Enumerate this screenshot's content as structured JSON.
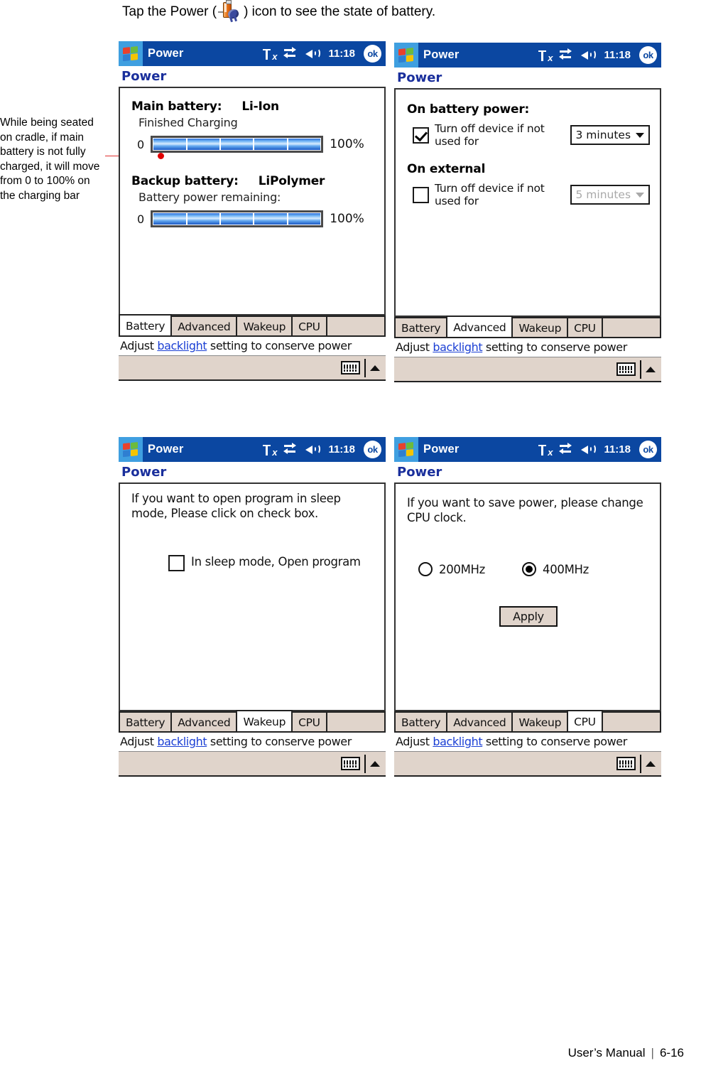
{
  "intro": {
    "before_icon": "Tap the Power (",
    "after_icon": ") icon to see the state of battery.",
    "icon_name": "power-battery-icon"
  },
  "annotation": {
    "text": "While being seated on cradle, if main battery is not fully charged, it will move from 0 to 100% on the charging bar",
    "line_color": "#e03030"
  },
  "common": {
    "titlebar": {
      "title": "Power",
      "time": "11:18",
      "ok_label": "ok",
      "icons": [
        "signal-off-icon",
        "connectivity-icon",
        "speaker-icon"
      ]
    },
    "page_heading": "Power",
    "tabs": [
      "Battery",
      "Advanced",
      "Wakeup",
      "CPU"
    ],
    "hint": {
      "prefix": "Adjust ",
      "link": "backlight",
      "suffix": " setting to conserve power"
    },
    "sip": {
      "keyboard_icon": "keyboard-icon",
      "caret_icon": "caret-up-icon"
    },
    "accent_titlebar": "#0b47a1",
    "accent_heading": "#1a2f9c",
    "tab_bg": "#e0d4cb",
    "link_color": "#1b3fd4"
  },
  "screens": [
    {
      "id": "battery",
      "active_tab": "Battery",
      "main_battery_label": "Main battery:",
      "main_battery_type": "Li-Ion",
      "main_battery_status": "Finished Charging",
      "main_gauge": {
        "min": "0",
        "max": "100%",
        "segments": 5,
        "fill_percent": 100
      },
      "backup_battery_label": "Backup battery:",
      "backup_battery_type": "LiPolymer",
      "backup_battery_status": "Battery power remaining:",
      "backup_gauge": {
        "min": "0",
        "max": "100%",
        "segments": 5,
        "fill_percent": 100
      }
    },
    {
      "id": "advanced",
      "active_tab": "Advanced",
      "battery_section_title": "On battery power:",
      "battery_option_label": "Turn off device if not used for",
      "battery_option_checked": true,
      "battery_timeout_value": "3 minutes",
      "battery_timeout_disabled": false,
      "external_section_title": "On external",
      "external_option_label": "Turn off device if not used for",
      "external_option_checked": false,
      "external_timeout_value": "5 minutes",
      "external_timeout_disabled": true
    },
    {
      "id": "wakeup",
      "active_tab": "Wakeup",
      "description": "If you want to open program in sleep mode, Please click on check box.",
      "checkbox_label": "In sleep mode, Open program",
      "checkbox_checked": false
    },
    {
      "id": "cpu",
      "active_tab": "CPU",
      "description": "If you want to save power, please change CPU clock.",
      "options": [
        {
          "label": "200MHz",
          "selected": false
        },
        {
          "label": "400MHz",
          "selected": true
        }
      ],
      "apply_label": "Apply"
    }
  ],
  "footer": {
    "manual": "User’s Manual",
    "separator": "|",
    "page": "6-16"
  }
}
